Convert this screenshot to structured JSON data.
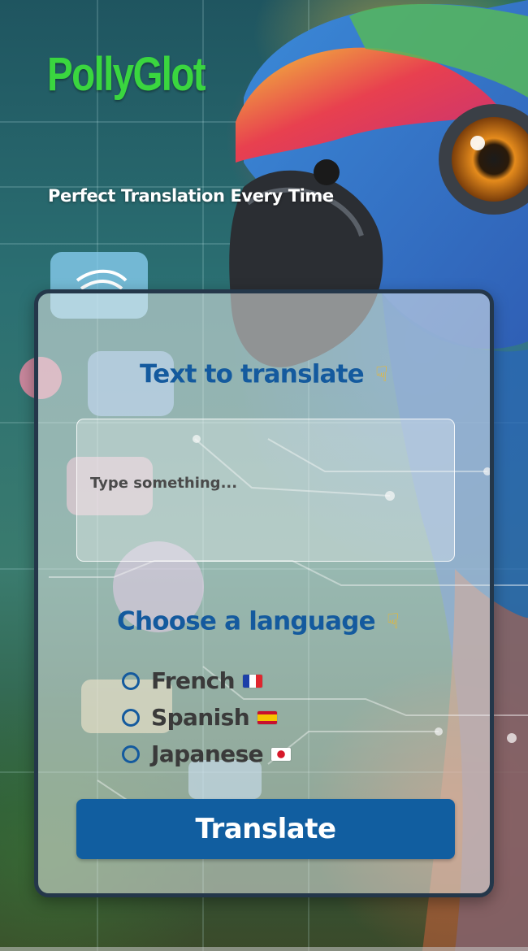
{
  "app": {
    "title": "PollyGlot",
    "tagline": "Perfect Translation Every Time"
  },
  "form": {
    "input_heading": "Text to translate",
    "input_placeholder": "Type something...",
    "input_value": "",
    "language_heading": "Choose a language",
    "languages": [
      {
        "label": "French",
        "flag_icon": "flag-france-icon",
        "selected": false
      },
      {
        "label": "Spanish",
        "flag_icon": "flag-spain-icon",
        "selected": false
      },
      {
        "label": "Japanese",
        "flag_icon": "flag-japan-icon",
        "selected": false
      }
    ],
    "submit_label": "Translate"
  },
  "icons": {
    "pointing_down": "point-down-icon"
  },
  "colors": {
    "brand_green": "#3ad63f",
    "heading_blue": "#145a9e",
    "button_blue": "#115ea0",
    "card_border": "#24374a"
  }
}
